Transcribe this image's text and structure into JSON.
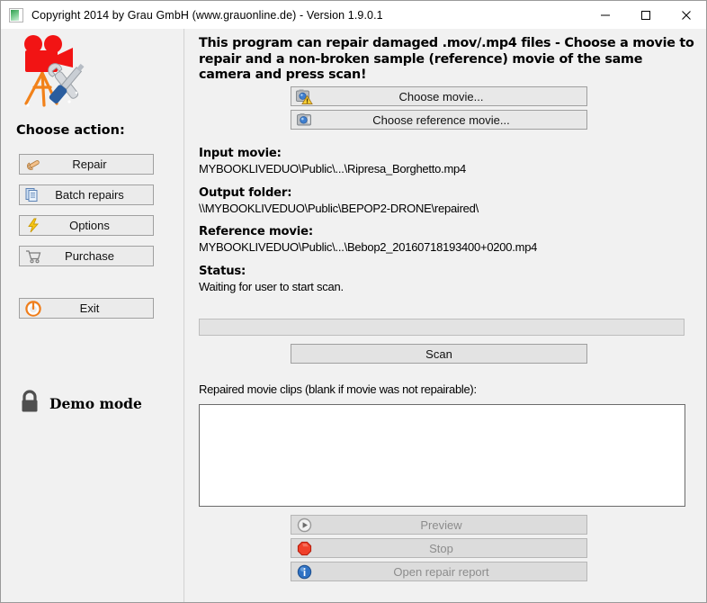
{
  "window": {
    "title": "Copyright 2014 by Grau GmbH (www.grauonline.de) - Version 1.9.0.1",
    "icon": "app-icon",
    "controls": {
      "minimize": "minimize-icon",
      "maximize": "maximize-icon",
      "close": "close-icon"
    }
  },
  "sidebar": {
    "logo_icon": "movie-camera-repair-logo",
    "heading": "Choose action:",
    "buttons": [
      {
        "label": "Repair",
        "icon": "wrench-icon"
      },
      {
        "label": "Batch repairs",
        "icon": "documents-icon"
      },
      {
        "label": "Options",
        "icon": "lightning-icon"
      },
      {
        "label": "Purchase",
        "icon": "shopping-cart-icon"
      },
      {
        "label": "Exit",
        "icon": "power-icon"
      }
    ],
    "status": {
      "label": "Demo mode",
      "icon": "padlock-icon"
    }
  },
  "main": {
    "headline": "This program can repair damaged .mov/.mp4 files - Choose a movie to repair and a non-broken sample (reference) movie of the same camera and press scan!",
    "choose_movie": {
      "label": "Choose movie...",
      "icon": "camera-warning-icon"
    },
    "choose_reference": {
      "label": "Choose reference movie...",
      "icon": "camera-icon"
    },
    "fields": [
      {
        "label": "Input movie:",
        "value": "MYBOOKLIVEDUO\\Public\\...\\Ripresa_Borghetto.mp4"
      },
      {
        "label": "Output folder:",
        "value": "\\\\MYBOOKLIVEDUO\\Public\\BEPOP2-DRONE\\repaired\\"
      },
      {
        "label": "Reference movie:",
        "value": "MYBOOKLIVEDUO\\Public\\...\\Bebop2_20160718193400+0200.mp4"
      },
      {
        "label": "Status:",
        "value": "Waiting for user to start scan."
      }
    ],
    "progress": {
      "percent": 0
    },
    "scan_label": "Scan",
    "clips_label": "Repaired movie clips (blank if movie was not repairable):",
    "clips": [],
    "bottom_buttons": [
      {
        "label": "Preview",
        "icon": "play-circle-icon",
        "disabled": true
      },
      {
        "label": "Stop",
        "icon": "stop-octagon-icon",
        "disabled": true
      },
      {
        "label": "Open repair report",
        "icon": "info-circle-icon",
        "disabled": true
      }
    ]
  },
  "colors": {
    "accent_red": "#ee1111",
    "accent_orange": "#f07d1a",
    "window_bg": "#f1f1f1",
    "button_bg": "#e8e8e8"
  }
}
